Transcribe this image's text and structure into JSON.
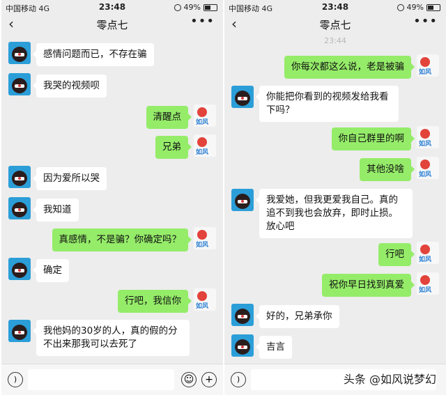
{
  "status": {
    "carrier": "中国移动",
    "network": "4G",
    "time": "23:48",
    "battery": "49%"
  },
  "chat": {
    "title": "零点七"
  },
  "left_messages": [
    {
      "dir": "in",
      "text": "感情问题而已，不存在骗"
    },
    {
      "dir": "in",
      "text": "我哭的视频呗"
    },
    {
      "dir": "out",
      "text": "清醒点"
    },
    {
      "dir": "out",
      "text": "兄弟"
    },
    {
      "dir": "in",
      "text": "因为爱所以哭"
    },
    {
      "dir": "in",
      "text": "我知道"
    },
    {
      "dir": "out",
      "text": "真感情，不是骗？你确定吗？"
    },
    {
      "dir": "in",
      "text": "确定"
    },
    {
      "dir": "out",
      "text": "行吧，我信你"
    },
    {
      "dir": "in",
      "text": "我他妈的30岁的人，真的假的分不出来那我可以去死了"
    }
  ],
  "right_timestamp": "23:44",
  "right_messages": [
    {
      "dir": "out",
      "text": "你每次都这么说，老是被骗"
    },
    {
      "dir": "in",
      "text": "你能把你看到的视频发给我看下吗？"
    },
    {
      "dir": "out",
      "text": "你自己群里的啊"
    },
    {
      "dir": "out",
      "text": "其他没啥"
    },
    {
      "dir": "in",
      "text": "我爱她，但我更爱我自己。真的追不到我也会放弃，即时止损。放心吧"
    },
    {
      "dir": "out",
      "text": "行吧"
    },
    {
      "dir": "out",
      "text": "祝你早日找到真爱"
    },
    {
      "dir": "in",
      "text": "好的，兄弟承你"
    },
    {
      "dir": "in",
      "text": "吉言"
    }
  ],
  "watermark": "头条 @如风说梦幻",
  "colors": {
    "sent_bubble": "#95ec69",
    "received_bubble": "#ffffff",
    "background": "#ededed"
  },
  "icons": [
    "back-arrow-icon",
    "more-dots-icon",
    "voice-icon",
    "emoji-icon",
    "plus-icon",
    "alarm-icon",
    "battery-icon"
  ]
}
